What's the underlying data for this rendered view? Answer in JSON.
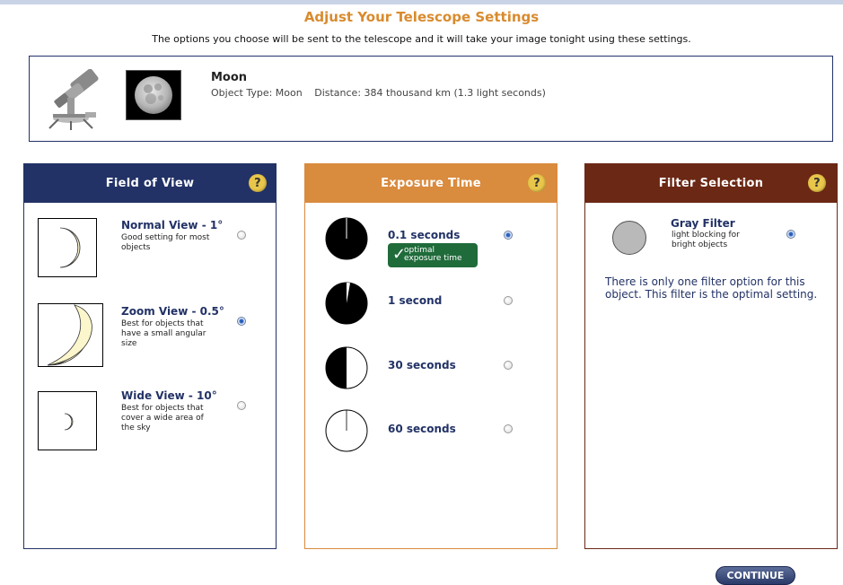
{
  "page": {
    "title": "Adjust Your Telescope Settings",
    "subtitle": "The options you choose will be sent to the telescope and it will take your image tonight using these settings."
  },
  "object": {
    "name": "Moon",
    "type_text": "Object Type: Moon",
    "distance_text": "Distance: 384 thousand km (1.3 light seconds)"
  },
  "field_of_view": {
    "header": "Field of View",
    "help": "?",
    "options": [
      {
        "title": "Normal View - 1°",
        "desc": "Good setting for most objects",
        "selected": false
      },
      {
        "title": "Zoom View - 0.5°",
        "desc": "Best for objects that have a small angular size",
        "selected": true
      },
      {
        "title": "Wide View - 10°",
        "desc": "Best for objects that cover a wide area of the sky",
        "selected": false
      }
    ]
  },
  "exposure_time": {
    "header": "Exposure Time",
    "help": "?",
    "options": [
      {
        "label": "0.1 seconds",
        "selected": true
      },
      {
        "label": "1 second",
        "selected": false
      },
      {
        "label": "30 seconds",
        "selected": false
      },
      {
        "label": "60 seconds",
        "selected": false
      }
    ],
    "badge_line1": "optimal",
    "badge_line2": "exposure time"
  },
  "filter_selection": {
    "header": "Filter Selection",
    "help": "?",
    "filter_title": "Gray Filter",
    "filter_desc": "light blocking for bright objects",
    "selected": true,
    "note": "There is only one filter option for this object. This filter is the optimal setting."
  },
  "continue_label": "CONTINUE",
  "colors": {
    "fov_header": "#223266",
    "exposure_header": "#d98b3e",
    "filter_header": "#6b2814",
    "title_orange": "#d98b2e",
    "badge_green": "#1f6b3a"
  }
}
